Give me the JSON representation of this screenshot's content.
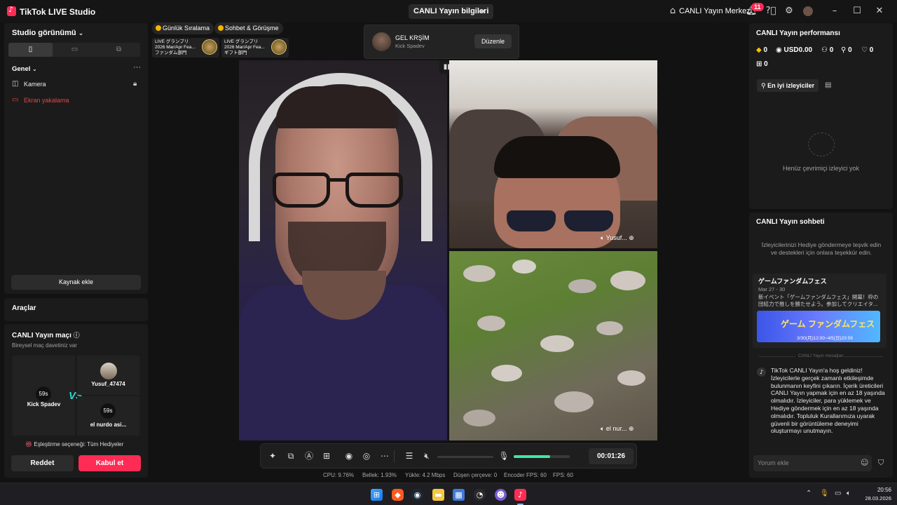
{
  "app": {
    "title": "TikTok LIVE Studio"
  },
  "titlebar": {
    "stream_info_label": "CANLI Yayın bilgileri",
    "live_center_label": "CANLI Yayın Merkezi",
    "notification_count": "11",
    "icons": [
      "share-icon",
      "home-icon",
      "bell-icon",
      "help-icon",
      "gear-icon",
      "avatar",
      "minimize-icon",
      "maximize-icon",
      "close-icon"
    ]
  },
  "left_panel": {
    "studio_view_label": "Studio görünümü",
    "general_label": "Genel",
    "sources": [
      {
        "label": "Kamera",
        "icon": "camera-icon",
        "locked": true
      },
      {
        "label": "Ekran yakalama",
        "icon": "monitor-icon",
        "locked": false
      }
    ],
    "add_source_label": "Kaynak ekle",
    "tools_label": "Araçlar"
  },
  "match_panel": {
    "title": "CANLI Yayın maçı",
    "subtitle": "Bireysel maç davetiniz var",
    "host": {
      "name": "Kick Spadev",
      "timer": "59s"
    },
    "vs_label": "VS",
    "opponents": [
      {
        "name": "Yusuf_47474",
        "timer": ""
      },
      {
        "name": "el nurdo asi...",
        "timer": "59s"
      }
    ],
    "match_option": "Eşleştirme seçeneği: Tüm Hediyeler",
    "reject_label": "Reddet",
    "accept_label": "Kabul et"
  },
  "top_chips": {
    "daily_ranking": "Günlük Sıralama",
    "chat_meet": "Sohbet & Görüşme",
    "rank_cards": [
      {
        "line1": "LIVE グランプリ",
        "line2": "2026 Mar/Apr Fea...",
        "line3": "ファンダム部門"
      },
      {
        "line1": "LIVE グランプリ",
        "line2": "2026 Mar/Apr Fea...",
        "line3": "ギフト部門"
      }
    ]
  },
  "guest_popup": {
    "title": "GEL KRŞİM",
    "subtitle": "Kick Spadev",
    "edit_label": "Düzenle"
  },
  "videos": {
    "guest1_label": "Yusuf...",
    "guest2_label": "el nur..."
  },
  "toolbar": {
    "timer": "00:01:26",
    "volume_level": 0.65
  },
  "stats": {
    "cpu": "CPU:  9.76%",
    "memory": "Bellek:  1.93%",
    "upload": "Yükle:  4.2 Mbps",
    "dropped": "Düşen çerçeve:  0",
    "encoder_fps": "Encoder FPS:  60",
    "fps": "FPS:  60"
  },
  "performance": {
    "title": "CANLI Yayın performansı",
    "diamonds": "0",
    "usd": "USD0.00",
    "viewers": "0",
    "followers": "0",
    "likes": "0",
    "gifts": "0",
    "top_viewers_label": "En iyi izleyiciler",
    "empty_label": "Henüz çevrimiçi izleyici yok"
  },
  "chat": {
    "title": "CANLI Yayın sohbeti",
    "hint": "İzleyicilerinizi Hediye göndermeye teşvik edin ve destekleri için onlara teşekkür edin.",
    "event_title": "ゲームファンダムフェス",
    "event_date": "Mar 27 - 30",
    "event_desc": "新イベント「ゲームファンダムフェス」開幕！枠の団結力で推しを勝たせよう。参加してクリエイタ...",
    "banner_text": "ゲーム ファンダムフェス",
    "banner_date": "3/30(月)12:00~4/5(日)23:59",
    "divider": "CANLI Yayın mesajları",
    "welcome": "TikTok CANLI Yayın'a hoş geldiniz! İzleyicilerle gerçek zamanlı etkileşimde bulunmanın keyfini çıkarın. İçerik üreticileri CANLI Yayın yapmak için en az 18 yaşında olmalıdır. İzleyiciler, para yüklemek ve Hediye göndermek için en az 18 yaşında olmalıdır. Topluluk Kurallarımıza uyarak güvenli bir görüntüleme deneyimi oluşturmayı unutmayın.",
    "input_placeholder": "Yorum ekle"
  },
  "taskbar": {
    "time": "20:56",
    "date": "28.03.2026"
  }
}
